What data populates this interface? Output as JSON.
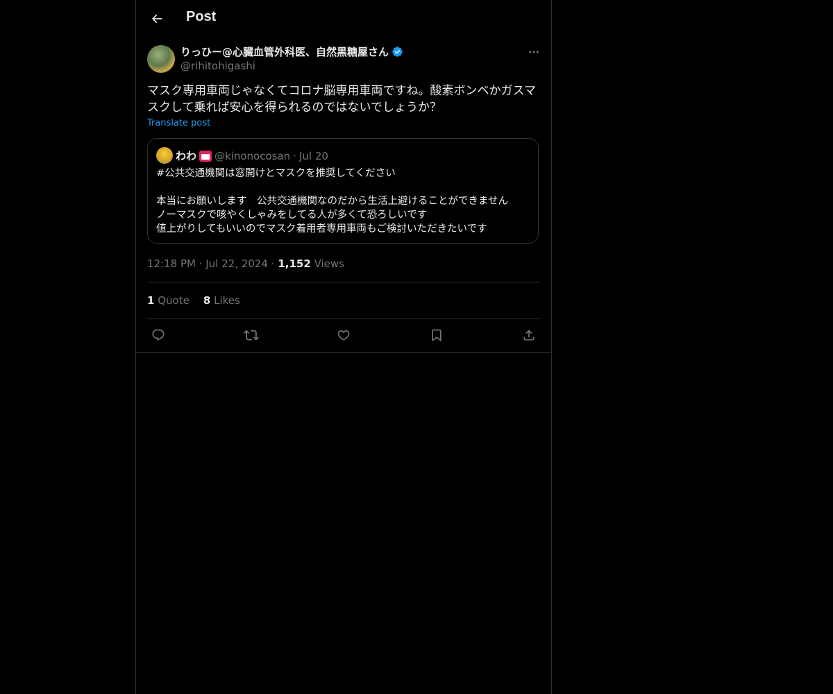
{
  "header": {
    "title": "Post"
  },
  "post": {
    "author_name": "りっひー@心臓血管外科医、自然黒糖屋さん",
    "handle": "@rihitohigashi",
    "text": "マスク専用車両じゃなくてコロナ脳専用車両ですね。酸素ボンベかガスマスクして乗れば安心を得られるのではないでしょうか？",
    "translate_label": "Translate post",
    "time": "12:18 PM",
    "date": "Jul 22, 2024",
    "views_count": "1,152",
    "views_label": "Views",
    "separator": "·"
  },
  "quoted": {
    "name": "わわ",
    "handle": "@kinonocosan",
    "date": "Jul 20",
    "separator": "·",
    "text": "#公共交通機関は窓開けとマスクを推奨してください\n\n本当にお願いします　公共交通機関なのだから生活上避けることができません\nノーマスクで咳やくしゃみをしてる人が多くて恐ろしいです\n値上がりしてもいいのでマスク着用者専用車両もご検討いただきたいです"
  },
  "stats": {
    "quotes_count": "1",
    "quotes_label": "Quote",
    "likes_count": "8",
    "likes_label": "Likes"
  },
  "icons": {
    "back": "arrow-left-icon",
    "more": "more-horizontal-icon",
    "verified": "verified-badge-icon",
    "reply": "reply-icon",
    "repost": "repost-icon",
    "like": "heart-icon",
    "bookmark": "bookmark-icon",
    "share": "share-icon"
  },
  "colors": {
    "background": "#000000",
    "text": "#e7e9ea",
    "secondary_text": "#71767b",
    "border": "#2f3336",
    "accent": "#1d9bf0"
  }
}
